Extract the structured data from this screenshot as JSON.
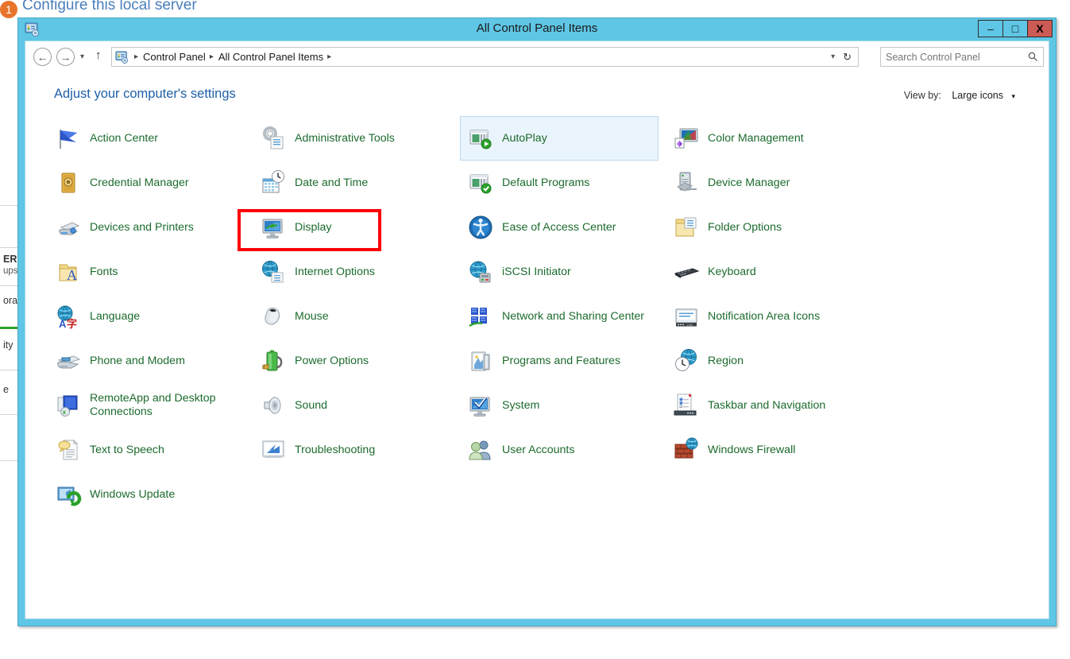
{
  "background": {
    "server_manager_heading": "Configure this local server",
    "heading_badge": "1",
    "side_rows": [
      {
        "text": "ER G",
        "bold": true
      },
      {
        "text": "ups:",
        "bold": false
      },
      {
        "text": "ora",
        "bold": false
      },
      {
        "text": "ity",
        "bold": false
      },
      {
        "text": "e",
        "bold": false
      }
    ]
  },
  "window": {
    "title": "All Control Panel Items",
    "title_icon": "control-panel-icon",
    "buttons": {
      "minimize": "–",
      "maximize": "□",
      "close": "X"
    }
  },
  "navbar": {
    "back_icon": "←",
    "forward_icon": "→",
    "recent_icon": "▾",
    "up_icon": "↑",
    "address_icon": "control-panel-icon",
    "breadcrumbs": [
      "Control Panel",
      "All Control Panel Items"
    ],
    "separator": "▸",
    "dropdown_caret": "▾",
    "refresh_icon": "↻",
    "search": {
      "placeholder": "Search Control Panel",
      "value": "",
      "icon": "search-icon"
    }
  },
  "content": {
    "page_title": "Adjust your computer's settings",
    "view_by_label": "View by:",
    "view_by_value": "Large icons",
    "view_by_caret": "▾"
  },
  "colors": {
    "title_bar": "#5fc6e5",
    "window_border": "#4aa8c4",
    "item_label": "#1c6b2e",
    "page_title": "#1f5fa9",
    "selection_fill": "#eaf4fc",
    "selection_border": "#b9d9ef",
    "highlight_box": "#fe0000",
    "close_button": "#cc5a55",
    "badge_orange": "#e8742c",
    "accent_green": "#2aa22a"
  },
  "items": {
    "column1": [
      {
        "label": "Action Center",
        "icon": "flag-icon",
        "selected": false
      },
      {
        "label": "Credential Manager",
        "icon": "vault-icon",
        "selected": false
      },
      {
        "label": "Devices and Printers",
        "icon": "printer-icon",
        "selected": false
      },
      {
        "label": "Fonts",
        "icon": "fonts-folder-icon",
        "selected": false
      },
      {
        "label": "Language",
        "icon": "globe-language-icon",
        "selected": false
      },
      {
        "label": "Phone and Modem",
        "icon": "fax-modem-icon",
        "selected": false
      },
      {
        "label": "RemoteApp and Desktop Connections",
        "icon": "remoteapp-icon",
        "selected": false
      },
      {
        "label": "Text to Speech",
        "icon": "speech-page-icon",
        "selected": false
      },
      {
        "label": "Windows Update",
        "icon": "windows-update-icon",
        "selected": false
      }
    ],
    "column2": [
      {
        "label": "Administrative Tools",
        "icon": "gear-list-icon",
        "selected": false
      },
      {
        "label": "Date and Time",
        "icon": "calendar-clock-icon",
        "selected": false,
        "highlighted": true
      },
      {
        "label": "Display",
        "icon": "monitor-icon",
        "selected": false
      },
      {
        "label": "Internet Options",
        "icon": "globe-list-icon",
        "selected": false
      },
      {
        "label": "Mouse",
        "icon": "mouse-icon",
        "selected": false
      },
      {
        "label": "Power Options",
        "icon": "battery-plug-icon",
        "selected": false
      },
      {
        "label": "Sound",
        "icon": "speaker-icon",
        "selected": false
      },
      {
        "label": "Troubleshooting",
        "icon": "troubleshoot-icon",
        "selected": false
      }
    ],
    "column3": [
      {
        "label": "AutoPlay",
        "icon": "autoplay-icon",
        "selected": true
      },
      {
        "label": "Default Programs",
        "icon": "default-programs-icon",
        "selected": false
      },
      {
        "label": "Ease of Access Center",
        "icon": "ease-of-access-icon",
        "selected": false
      },
      {
        "label": "iSCSI Initiator",
        "icon": "iscsi-icon",
        "selected": false
      },
      {
        "label": "Network and Sharing Center",
        "icon": "network-icon",
        "selected": false
      },
      {
        "label": "Programs and Features",
        "icon": "programs-icon",
        "selected": false
      },
      {
        "label": "System",
        "icon": "system-icon",
        "selected": false
      },
      {
        "label": "User Accounts",
        "icon": "user-accounts-icon",
        "selected": false
      }
    ],
    "column4": [
      {
        "label": "Color Management",
        "icon": "color-management-icon",
        "selected": false
      },
      {
        "label": "Device Manager",
        "icon": "device-manager-icon",
        "selected": false
      },
      {
        "label": "Folder Options",
        "icon": "folder-options-icon",
        "selected": false
      },
      {
        "label": "Keyboard",
        "icon": "keyboard-icon",
        "selected": false
      },
      {
        "label": "Notification Area Icons",
        "icon": "notification-area-icon",
        "selected": false
      },
      {
        "label": "Region",
        "icon": "region-icon",
        "selected": false
      },
      {
        "label": "Taskbar and Navigation",
        "icon": "taskbar-icon",
        "selected": false
      },
      {
        "label": "Windows Firewall",
        "icon": "firewall-icon",
        "selected": false
      }
    ]
  }
}
